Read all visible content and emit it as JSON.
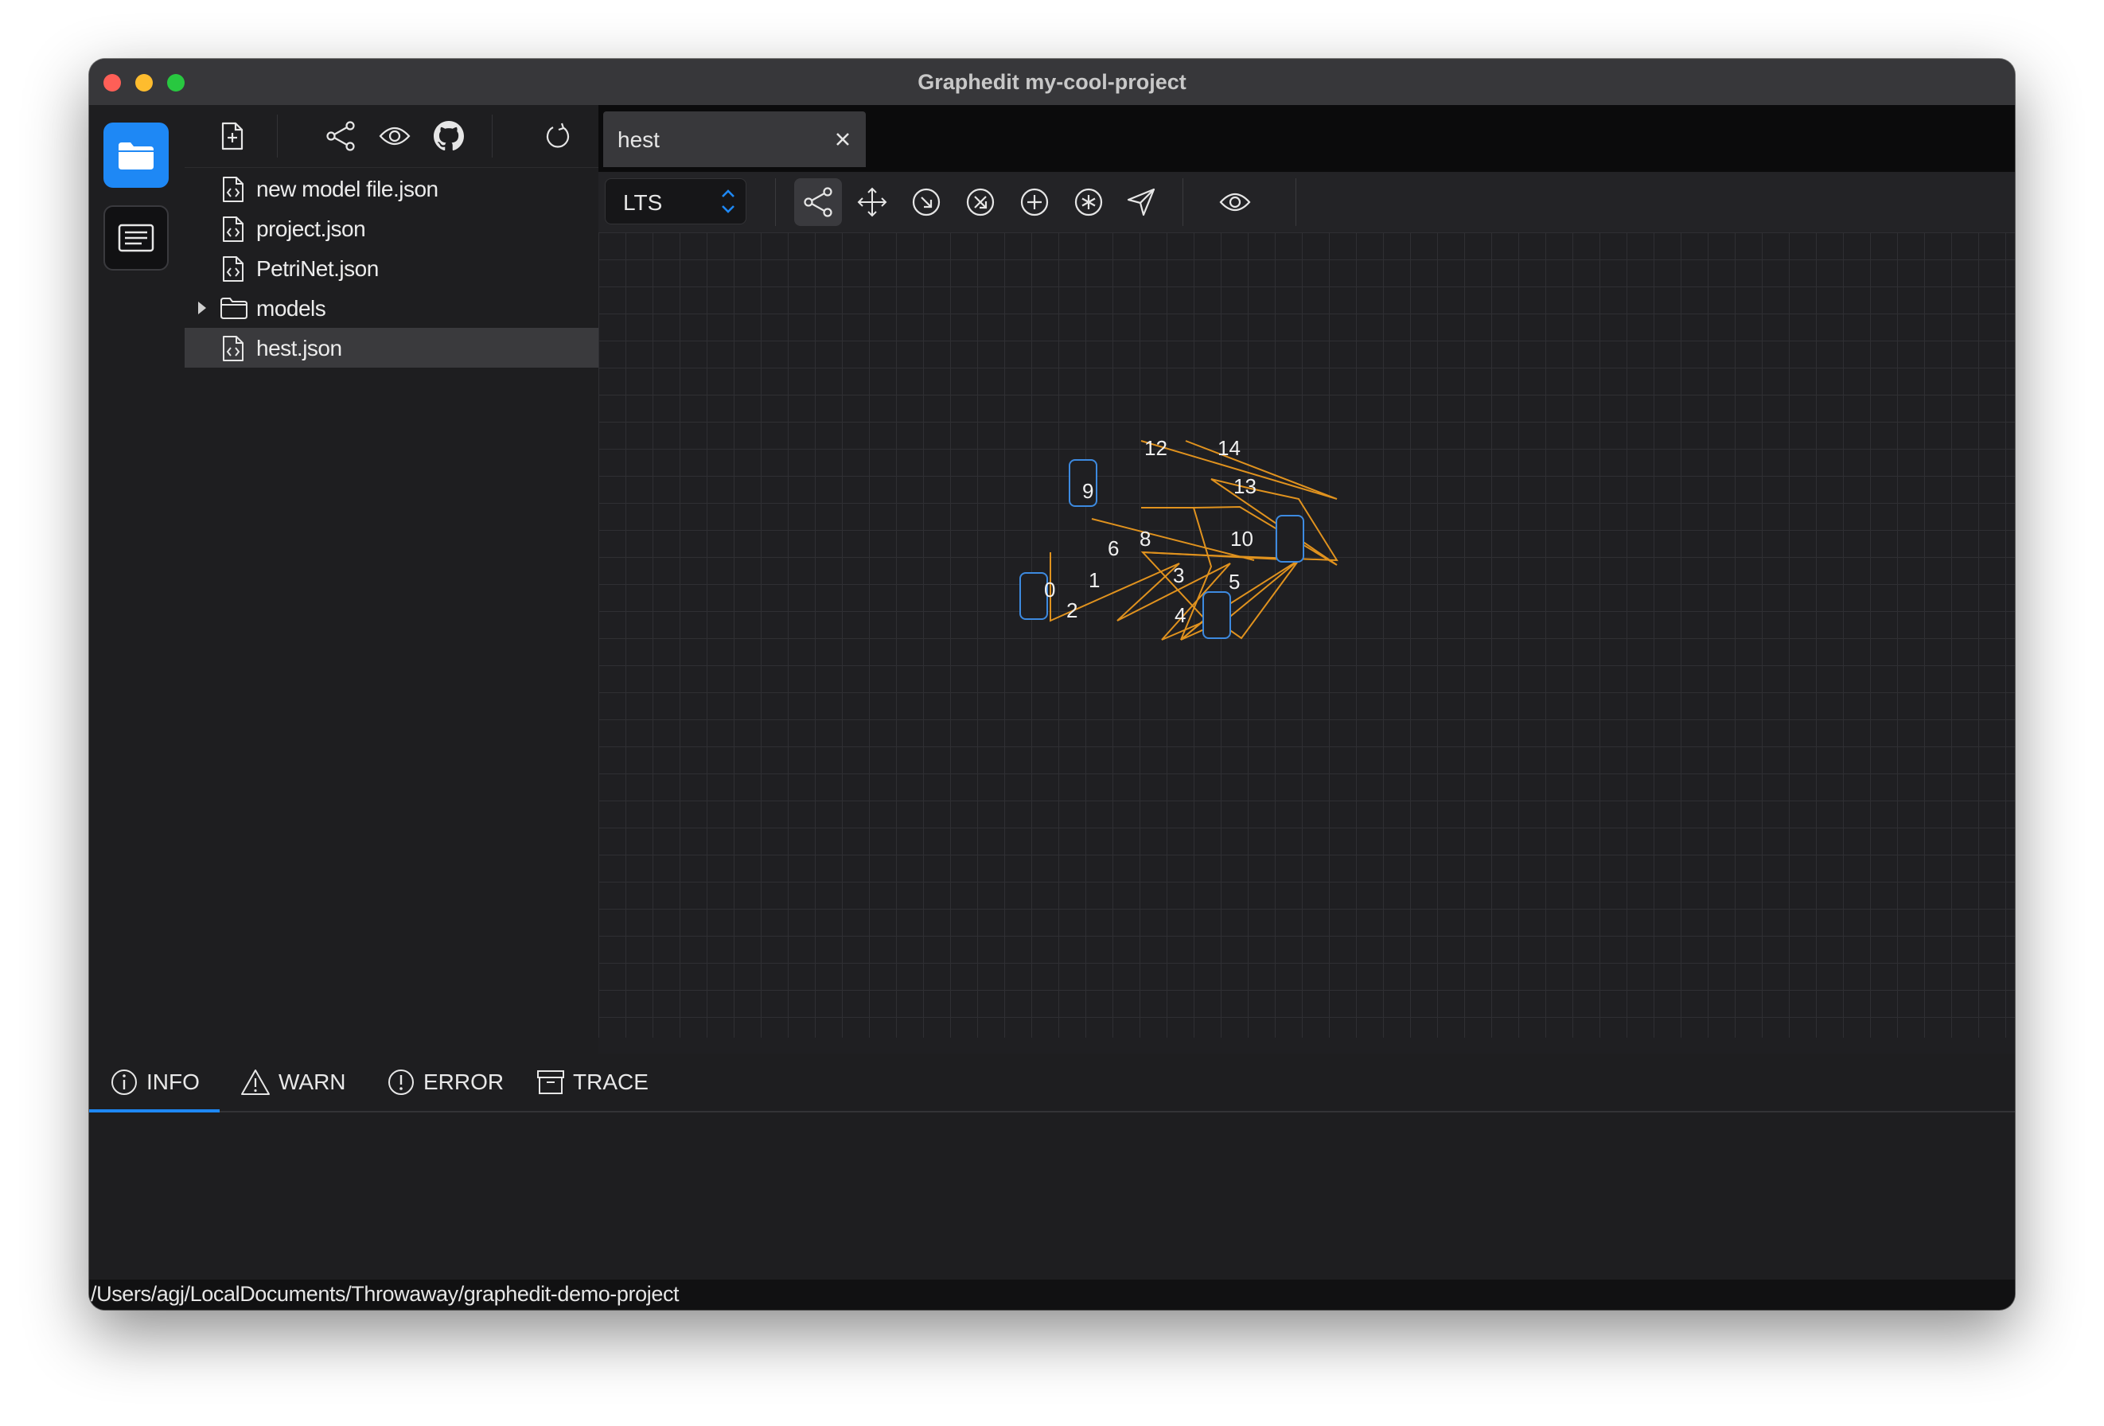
{
  "window": {
    "title": "Graphedit my-cool-project"
  },
  "explorer": {
    "files": [
      {
        "name": "new model file.json",
        "type": "file"
      },
      {
        "name": "project.json",
        "type": "file"
      },
      {
        "name": "PetriNet.json",
        "type": "file"
      },
      {
        "name": "models",
        "type": "folder"
      },
      {
        "name": "hest.json",
        "type": "file",
        "selected": true
      }
    ]
  },
  "editor": {
    "tab": {
      "label": "hest"
    },
    "model_type": "LTS",
    "graph": {
      "edge_color": "#e0921e",
      "node_color": "#3d8ae0",
      "edge_labels": [
        "0",
        "1",
        "2",
        "3",
        "4",
        "5",
        "6",
        "8",
        "9",
        "10",
        "12",
        "13",
        "14"
      ]
    }
  },
  "log": {
    "tabs": [
      {
        "label": "INFO",
        "active": true
      },
      {
        "label": "WARN"
      },
      {
        "label": "ERROR"
      },
      {
        "label": "TRACE"
      }
    ]
  },
  "status": {
    "path": "/Users/agj/LocalDocuments/Throwaway/graphedit-demo-project"
  }
}
